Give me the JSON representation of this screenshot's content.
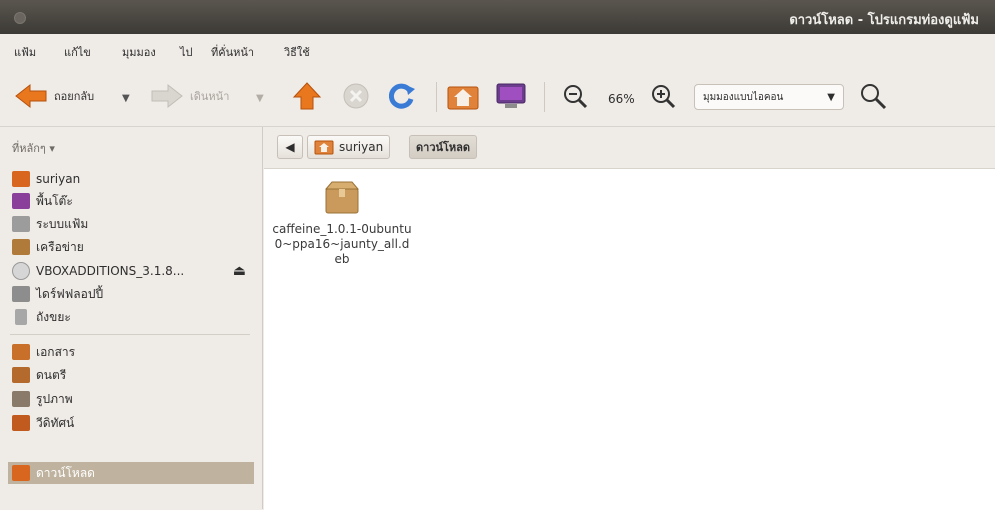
{
  "window": {
    "title": "ดาวน์โหลด - โปรแกรมท่องดูแฟ้ม"
  },
  "menu": [
    "แฟ้ม",
    "แก้ไข",
    "มุมมอง",
    "ไป",
    "ที่คั่นหน้า",
    "วิธีใช้"
  ],
  "toolbar": {
    "back_label": "ถอยกลับ",
    "forward_label": "เดินหน้า",
    "zoom": "66%",
    "view_mode": "มุมมองแบบไอคอน"
  },
  "sidebar": {
    "header": "ที่หลักๆ",
    "places": [
      {
        "label": "suriyan",
        "icon": "home-folder-icon",
        "color": "#d9661f"
      },
      {
        "label": "พื้นโต๊ะ",
        "icon": "desktop-icon",
        "color": "#8a3f9a"
      },
      {
        "label": "ระบบแฟ้ม",
        "icon": "filesystem-icon",
        "color": "#9c9c9c"
      },
      {
        "label": "เครือข่าย",
        "icon": "network-icon",
        "color": "#b07a3a"
      },
      {
        "label": "VBOXADDITIONS_3.1.8...",
        "icon": "cdrom-icon",
        "color": "#c9c9c9"
      },
      {
        "label": "ไดร์ฟฟลอปปี้",
        "icon": "floppy-icon",
        "color": "#8d8d8d"
      },
      {
        "label": "ถังขยะ",
        "icon": "trash-icon",
        "color": "#a7a7a7"
      }
    ],
    "bookmarks": [
      {
        "label": "เอกสาร",
        "icon": "documents-icon",
        "color": "#c86f2a"
      },
      {
        "label": "ดนตรี",
        "icon": "music-icon",
        "color": "#b46a2c"
      },
      {
        "label": "รูปภาพ",
        "icon": "pictures-icon",
        "color": "#8a7a6a"
      },
      {
        "label": "วีดิทัศน์",
        "icon": "videos-icon",
        "color": "#c05a1e"
      },
      {
        "label": "ดาวน์โหลด",
        "icon": "downloads-icon",
        "color": "#d9661f"
      }
    ]
  },
  "pathbar": {
    "home_label": "suriyan",
    "current_label": "ดาวน์โหลด"
  },
  "files": [
    {
      "name": "caffeine_1.0.1-0ubuntu0~ppa16~jaunty_all.deb",
      "icon": "package-icon"
    }
  ],
  "colors": {
    "selection": "#bfb39f",
    "titlebar": "#3c3a36",
    "accent_orange": "#e8771e"
  }
}
